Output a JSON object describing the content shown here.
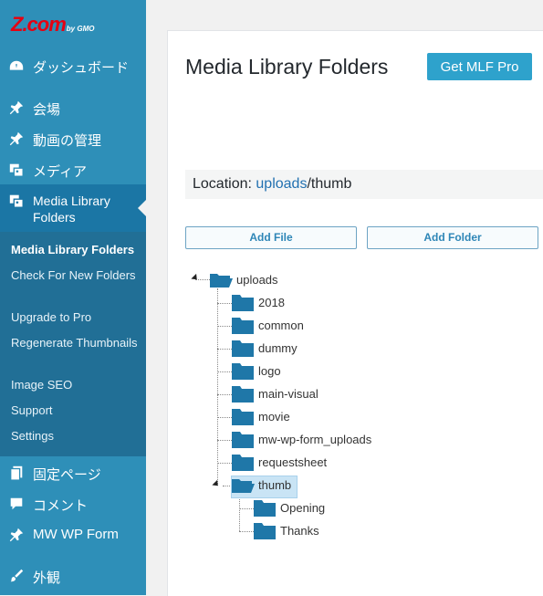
{
  "brand": {
    "logo_text": "Z.com",
    "logo_sub": "by GMO"
  },
  "sidebar": {
    "items": [
      {
        "label": "ダッシュボード",
        "icon": "dashboard-icon"
      },
      {
        "label": "会場",
        "icon": "pin-icon"
      },
      {
        "label": "動画の管理",
        "icon": "pin-icon"
      },
      {
        "label": "メディア",
        "icon": "media-icon"
      },
      {
        "label": "Media Library Folders",
        "icon": "media-icon"
      },
      {
        "label": "固定ページ",
        "icon": "pages-icon"
      },
      {
        "label": "コメント",
        "icon": "comment-icon"
      },
      {
        "label": "MW WP Form",
        "icon": "pin-icon"
      },
      {
        "label": "外観",
        "icon": "brush-icon"
      }
    ],
    "current_line1": "Media Library",
    "current_line2": "Folders",
    "submenu": [
      "Media Library Folders",
      "Check For New Folders",
      "Upgrade to Pro",
      "Regenerate Thumbnails",
      "Image SEO",
      "Support",
      "Settings"
    ]
  },
  "main": {
    "title": "Media Library Folders",
    "pro_button": "Get MLF Pro",
    "location_label": "Location: ",
    "location_link": "uploads",
    "location_rest": "/thumb",
    "add_file": "Add File",
    "add_folder": "Add Folder"
  },
  "tree": {
    "root": "uploads",
    "children": [
      "2018",
      "common",
      "dummy",
      "logo",
      "main-visual",
      "movie",
      "mw-wp-form_uploads",
      "requestsheet",
      "thumb"
    ],
    "thumb_children": [
      "Opening",
      "Thanks"
    ],
    "selected": "thumb"
  },
  "colors": {
    "sidebar_bg": "#2e8fb8",
    "sidebar_current": "#1b76a5",
    "submenu_bg": "#216f96",
    "accent_button": "#2ea2cc",
    "folder": "#1f77a8",
    "logo_red": "#e60012"
  }
}
